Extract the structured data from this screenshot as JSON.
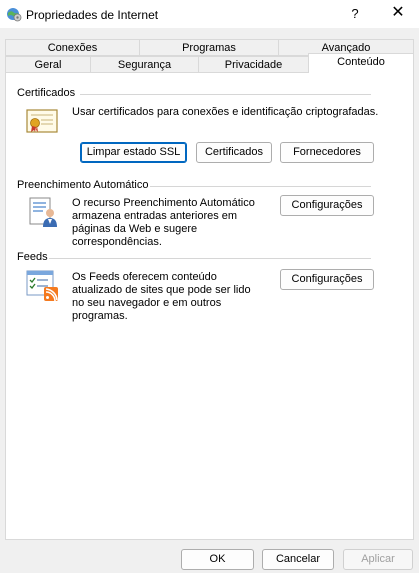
{
  "window": {
    "title": "Propriedades de Internet",
    "help_glyph": "?",
    "close_glyph": "✕"
  },
  "tabs": {
    "row1": [
      "Conexões",
      "Programas",
      "Avançado"
    ],
    "row2": [
      "Geral",
      "Segurança",
      "Privacidade",
      "Conteúdo"
    ],
    "active": "Conteúdo"
  },
  "certificates": {
    "label": "Certificados",
    "description": "Usar certificados para conexões e identificação criptografadas.",
    "clear_ssl": "Limpar estado SSL",
    "certificates_btn": "Certificados",
    "publishers_btn": "Fornecedores"
  },
  "autocomplete": {
    "label": "Preenchimento Automático",
    "description_lines": [
      "O recurso Preenchimento Automático",
      "armazena entradas anteriores em",
      "páginas da Web e sugere",
      "correspondências."
    ],
    "settings_btn": "Configurações"
  },
  "feeds": {
    "label": "Feeds",
    "description_lines": [
      "Os Feeds oferecem conteúdo",
      "atualizado de sites que pode ser lido",
      "no seu navegador e em outros",
      "programas."
    ],
    "settings_btn": "Configurações"
  },
  "footer": {
    "ok": "OK",
    "cancel": "Cancelar",
    "apply": "Aplicar"
  },
  "icons": {
    "app": "internet-options-icon",
    "certificate": "certificate-icon",
    "autocomplete": "autocomplete-icon",
    "feeds": "feeds-icon"
  },
  "colors": {
    "accent": "#0067c0",
    "rss": "#f47a20"
  }
}
